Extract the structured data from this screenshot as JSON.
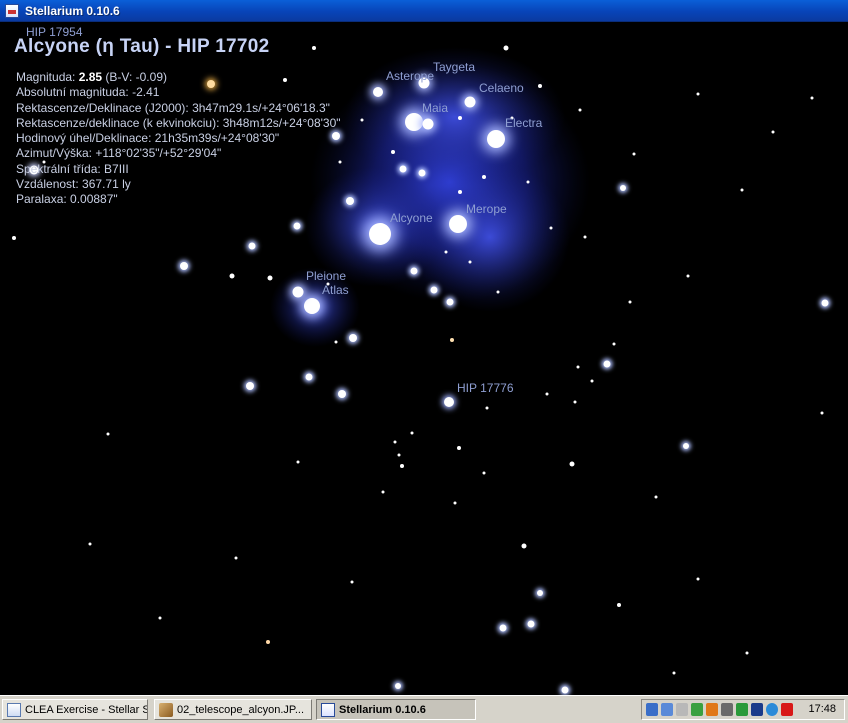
{
  "window": {
    "title": "Stellarium 0.10.6"
  },
  "object": {
    "title": "Alcyone (η Tau) - HIP 17702",
    "info": [
      {
        "label": "Magnituda: ",
        "bold": "2.85",
        "rest": " (B-V: -0.09)"
      },
      {
        "label": "Absolutní magnituda: -2.41",
        "bold": "",
        "rest": ""
      },
      {
        "label": "Rektascenze/Deklinace (J2000): 3h47m29.1s/+24°06'18.3\"",
        "bold": "",
        "rest": ""
      },
      {
        "label": "Rektascenze/deklinace (k ekvinokciu): 3h48m12s/+24°08'30\"",
        "bold": "",
        "rest": ""
      },
      {
        "label": "Hodinový úhel/Deklinace: 21h35m39s/+24°08'30\"",
        "bold": "",
        "rest": ""
      },
      {
        "label": "Azimut/Výška: +118°02'35\"/+52°29'04\"",
        "bold": "",
        "rest": ""
      },
      {
        "label": "Spektrální třída: B7III",
        "bold": "",
        "rest": ""
      },
      {
        "label": "Vzdálenost: 367.71 ly",
        "bold": "",
        "rest": ""
      },
      {
        "label": "Paralaxa: 0.00887\"",
        "bold": "",
        "rest": ""
      }
    ]
  },
  "labels": {
    "hip17954": "HIP 17954",
    "asterope": "Asterope",
    "taygeta": "Taygeta",
    "celaeno": "Celaeno",
    "maia": "Maia",
    "electra": "Electra",
    "alcyone": "Alcyone",
    "merope": "Merope",
    "pleione": "Pleione",
    "atlas": "Atlas",
    "hip17776": "HIP 17776"
  },
  "taskbar": {
    "tasks": [
      {
        "label": "CLEA Exercise - Stellar S...",
        "active": false
      },
      {
        "label": "02_telescope_alcyon.JP...",
        "active": false
      },
      {
        "label": "Stellarium 0.10.6",
        "active": true
      }
    ],
    "clock": "17:48"
  },
  "colors": {
    "label": "#8f9fd2",
    "nebula": "#2a3ad8"
  }
}
